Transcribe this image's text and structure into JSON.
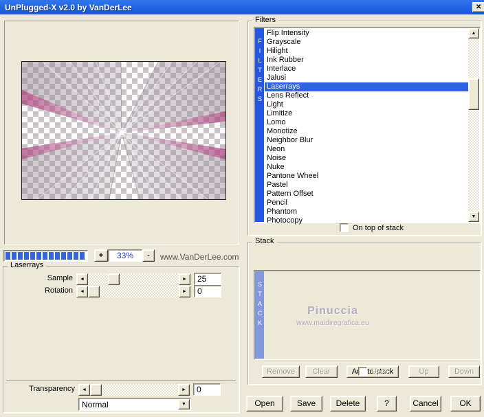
{
  "window": {
    "title": "UnPlugged-X v2.0 by VanDerLee",
    "close_glyph": "✕"
  },
  "icons": {
    "left_arrow": "◄",
    "right_arrow": "►",
    "up_arrow": "▲",
    "down_arrow": "▼",
    "combo_arrow": "▼"
  },
  "preview": {
    "progress_segments": 13,
    "zoom_in_label": "+",
    "zoom_out_label": "-",
    "zoom_percent": "33%",
    "website": "www.VanDerLee.com"
  },
  "params": {
    "group_label": "Laserrays",
    "sample_label": "Sample",
    "sample_value": "25",
    "rotation_label": "Rotation",
    "rotation_value": "0",
    "transparency_label": "Transparency",
    "transparency_value": "0",
    "blend_mode": "Normal"
  },
  "filter_panel": {
    "group_label": "Filters",
    "strip_letters": "FILTERS",
    "selected_index": 6,
    "items": [
      "Flip Intensity",
      "Grayscale",
      "Hilight",
      "Ink Rubber",
      "Interlace",
      "Jalusi",
      "Laserrays",
      "Lens Reflect",
      "Light",
      "Limitize",
      "Lomo",
      "Monotize",
      "Neighbor Blur",
      "Neon",
      "Noise",
      "Nuke",
      "Pantone Wheel",
      "Pastel",
      "Pattern Offset",
      "Pencil",
      "Phantom",
      "Photocopy"
    ],
    "on_top_label": "On top of stack"
  },
  "stack": {
    "group_label": "Stack",
    "add_button": "Add to stack",
    "strip_letters": "STACK",
    "watermark_name": "Pinuccia",
    "watermark_url": "www.maidiregrafica.eu",
    "remove_label": "Remove",
    "clear_label": "Clear",
    "upto_label": "Upto",
    "up_label": "Up",
    "down_label": "Down"
  },
  "footer_buttons": [
    "Open",
    "Save",
    "Delete",
    "?",
    "Cancel",
    "OK"
  ],
  "colors": {
    "titlebar_top": "#3077ec",
    "titlebar_bottom": "#1b55ce",
    "strip_blue": "#2457e2",
    "selection_blue": "#2e62de",
    "stack_strip": "#8397dc",
    "progress_blue": "#3565dd",
    "zoom_text": "#2433c8",
    "watermark": "#b3abc2",
    "disabled_text": "#a09d90",
    "site_text": "#55524a"
  }
}
